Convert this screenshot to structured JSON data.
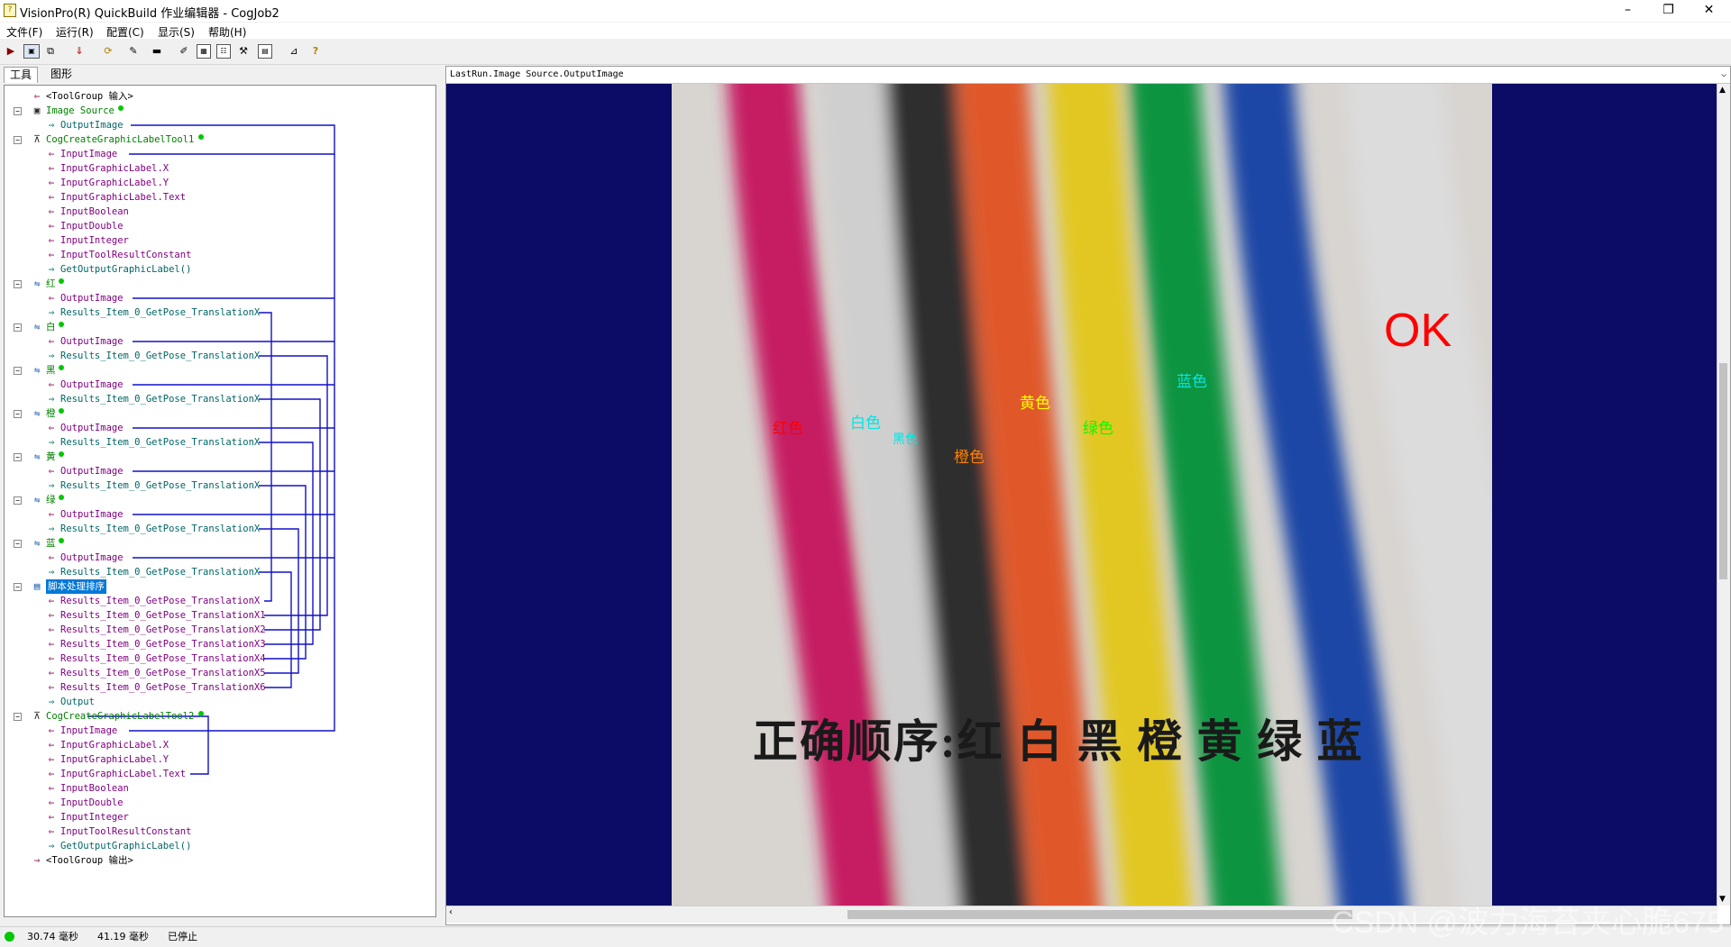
{
  "window": {
    "title": "VisionPro(R) QuickBuild 作业编辑器 - CogJob2",
    "minimize": "–",
    "maximize": "❐",
    "close": "✕"
  },
  "menu": [
    "文件(F)",
    "运行(R)",
    "配置(C)",
    "显示(S)",
    "帮助(H)"
  ],
  "toolbar": {
    "icons": [
      "run-icon",
      "display-icon",
      "copy-icon",
      "import-icon",
      "refresh-icon",
      "paint-icon",
      "minus-icon",
      "edit-icon",
      "grid-icon",
      "table-icon",
      "tools-icon",
      "image-icon",
      "measure-icon",
      "help-icon"
    ]
  },
  "tabs": [
    "工具",
    "图形"
  ],
  "tree": [
    {
      "level": 1,
      "icon": "arrow-in",
      "label": "<ToolGroup 输入>",
      "color": "#000000"
    },
    {
      "level": 1,
      "icon": "camera",
      "label": "Image Source",
      "color": "#008000",
      "expand": "minus",
      "dot": true
    },
    {
      "level": 2,
      "icon": "arrow-out",
      "label": "OutputImage",
      "color": "#006666"
    },
    {
      "level": 1,
      "icon": "label-tool",
      "label": "CogCreateGraphicLabelTool1",
      "color": "#008000",
      "expand": "minus",
      "dot": true
    },
    {
      "level": 2,
      "icon": "arrow-in",
      "label": "InputImage",
      "color": "#800080"
    },
    {
      "level": 2,
      "icon": "arrow-in",
      "label": "InputGraphicLabel.X",
      "color": "#800080"
    },
    {
      "level": 2,
      "icon": "arrow-in",
      "label": "InputGraphicLabel.Y",
      "color": "#800080"
    },
    {
      "level": 2,
      "icon": "arrow-in",
      "label": "InputGraphicLabel.Text",
      "color": "#800080"
    },
    {
      "level": 2,
      "icon": "arrow-in",
      "label": "InputBoolean",
      "color": "#800080"
    },
    {
      "level": 2,
      "icon": "arrow-in",
      "label": "InputDouble",
      "color": "#800080"
    },
    {
      "level": 2,
      "icon": "arrow-in",
      "label": "InputInteger",
      "color": "#800080"
    },
    {
      "level": 2,
      "icon": "arrow-in",
      "label": "InputToolResultConstant",
      "color": "#800080"
    },
    {
      "level": 2,
      "icon": "arrow-out",
      "label": "GetOutputGraphicLabel()",
      "color": "#006666"
    },
    {
      "level": 1,
      "icon": "blob-tool",
      "label": "红",
      "color": "#008000",
      "expand": "minus",
      "dot": true
    },
    {
      "level": 2,
      "icon": "arrow-in",
      "label": "OutputImage",
      "color": "#800080"
    },
    {
      "level": 2,
      "icon": "arrow-out",
      "label": "Results_Item_0_GetPose_TranslationX",
      "color": "#006666"
    },
    {
      "level": 1,
      "icon": "blob-tool",
      "label": "白",
      "color": "#008000",
      "expand": "minus",
      "dot": true
    },
    {
      "level": 2,
      "icon": "arrow-in",
      "label": "OutputImage",
      "color": "#800080"
    },
    {
      "level": 2,
      "icon": "arrow-out",
      "label": "Results_Item_0_GetPose_TranslationX",
      "color": "#006666"
    },
    {
      "level": 1,
      "icon": "blob-tool",
      "label": "黑",
      "color": "#008000",
      "expand": "minus",
      "dot": true
    },
    {
      "level": 2,
      "icon": "arrow-in",
      "label": "OutputImage",
      "color": "#800080"
    },
    {
      "level": 2,
      "icon": "arrow-out",
      "label": "Results_Item_0_GetPose_TranslationX",
      "color": "#006666"
    },
    {
      "level": 1,
      "icon": "blob-tool",
      "label": "橙",
      "color": "#008000",
      "expand": "minus",
      "dot": true
    },
    {
      "level": 2,
      "icon": "arrow-in",
      "label": "OutputImage",
      "color": "#800080"
    },
    {
      "level": 2,
      "icon": "arrow-out",
      "label": "Results_Item_0_GetPose_TranslationX",
      "color": "#006666"
    },
    {
      "level": 1,
      "icon": "blob-tool",
      "label": "黄",
      "color": "#008000",
      "expand": "minus",
      "dot": true
    },
    {
      "level": 2,
      "icon": "arrow-in",
      "label": "OutputImage",
      "color": "#800080"
    },
    {
      "level": 2,
      "icon": "arrow-out",
      "label": "Results_Item_0_GetPose_TranslationX",
      "color": "#006666"
    },
    {
      "level": 1,
      "icon": "blob-tool",
      "label": "绿",
      "color": "#008000",
      "expand": "minus",
      "dot": true
    },
    {
      "level": 2,
      "icon": "arrow-in",
      "label": "OutputImage",
      "color": "#800080"
    },
    {
      "level": 2,
      "icon": "arrow-out",
      "label": "Results_Item_0_GetPose_TranslationX",
      "color": "#006666"
    },
    {
      "level": 1,
      "icon": "blob-tool",
      "label": "蓝",
      "color": "#008000",
      "expand": "minus",
      "dot": true
    },
    {
      "level": 2,
      "icon": "arrow-in",
      "label": "OutputImage",
      "color": "#800080"
    },
    {
      "level": 2,
      "icon": "arrow-out",
      "label": "Results_Item_0_GetPose_TranslationX",
      "color": "#006666"
    },
    {
      "level": 1,
      "icon": "script-tool",
      "label": "脚本处理排序",
      "color": "#ffffff",
      "expand": "minus",
      "selected": true
    },
    {
      "level": 2,
      "icon": "arrow-in",
      "label": "Results_Item_0_GetPose_TranslationX",
      "color": "#800080"
    },
    {
      "level": 2,
      "icon": "arrow-in",
      "label": "Results_Item_0_GetPose_TranslationX1",
      "color": "#800080"
    },
    {
      "level": 2,
      "icon": "arrow-in",
      "label": "Results_Item_0_GetPose_TranslationX2",
      "color": "#800080"
    },
    {
      "level": 2,
      "icon": "arrow-in",
      "label": "Results_Item_0_GetPose_TranslationX3",
      "color": "#800080"
    },
    {
      "level": 2,
      "icon": "arrow-in",
      "label": "Results_Item_0_GetPose_TranslationX4",
      "color": "#800080"
    },
    {
      "level": 2,
      "icon": "arrow-in",
      "label": "Results_Item_0_GetPose_TranslationX5",
      "color": "#800080"
    },
    {
      "level": 2,
      "icon": "arrow-in",
      "label": "Results_Item_0_GetPose_TranslationX6",
      "color": "#800080"
    },
    {
      "level": 2,
      "icon": "arrow-out",
      "label": "Output",
      "color": "#006666"
    },
    {
      "level": 1,
      "icon": "label-tool",
      "label": "CogCreateGraphicLabelTool2",
      "color": "#008000",
      "expand": "minus",
      "dot": true
    },
    {
      "level": 2,
      "icon": "arrow-in",
      "label": "InputImage",
      "color": "#800080"
    },
    {
      "level": 2,
      "icon": "arrow-in",
      "label": "InputGraphicLabel.X",
      "color": "#800080"
    },
    {
      "level": 2,
      "icon": "arrow-in",
      "label": "InputGraphicLabel.Y",
      "color": "#800080"
    },
    {
      "level": 2,
      "icon": "arrow-in",
      "label": "InputGraphicLabel.Text",
      "color": "#800080"
    },
    {
      "level": 2,
      "icon": "arrow-in",
      "label": "InputBoolean",
      "color": "#800080"
    },
    {
      "level": 2,
      "icon": "arrow-in",
      "label": "InputDouble",
      "color": "#800080"
    },
    {
      "level": 2,
      "icon": "arrow-in",
      "label": "InputInteger",
      "color": "#800080"
    },
    {
      "level": 2,
      "icon": "arrow-in",
      "label": "InputToolResultConstant",
      "color": "#800080"
    },
    {
      "level": 2,
      "icon": "arrow-out",
      "label": "GetOutputGraphicLabel()",
      "color": "#006666"
    },
    {
      "level": 1,
      "icon": "arrow-out-group",
      "label": "<ToolGroup 输出>",
      "color": "#000000"
    }
  ],
  "viewer": {
    "source_path": "LastRun.Image Source.OutputImage",
    "result_text": "OK",
    "result_color": "#ff0000",
    "bottom_caption": "正确顺序:红 白 黑 橙 黄 绿 蓝",
    "wire_colors": [
      "#c61f62",
      "#cfcfcf",
      "#2f2f2f",
      "#e0582c",
      "#e2c722",
      "#0b9440",
      "#1f47a6",
      "#dcdcdc"
    ],
    "labels": [
      {
        "text": "红色",
        "color": "#ff0000"
      },
      {
        "text": "白色",
        "color": "#00e5e5"
      },
      {
        "text": "黑色",
        "color": "#00e5e5"
      },
      {
        "text": "橙色",
        "color": "#ff7f00"
      },
      {
        "text": "黄色",
        "color": "#ffff00"
      },
      {
        "text": "绿色",
        "color": "#00ff00"
      },
      {
        "text": "蓝色",
        "color": "#00e5e5"
      }
    ]
  },
  "status": {
    "indicator_color": "#00c800",
    "time1": "30.74 毫秒",
    "time2": "41.19 毫秒",
    "state": "已停止"
  },
  "watermark": "CSDN @波力海苔夹心脆675"
}
